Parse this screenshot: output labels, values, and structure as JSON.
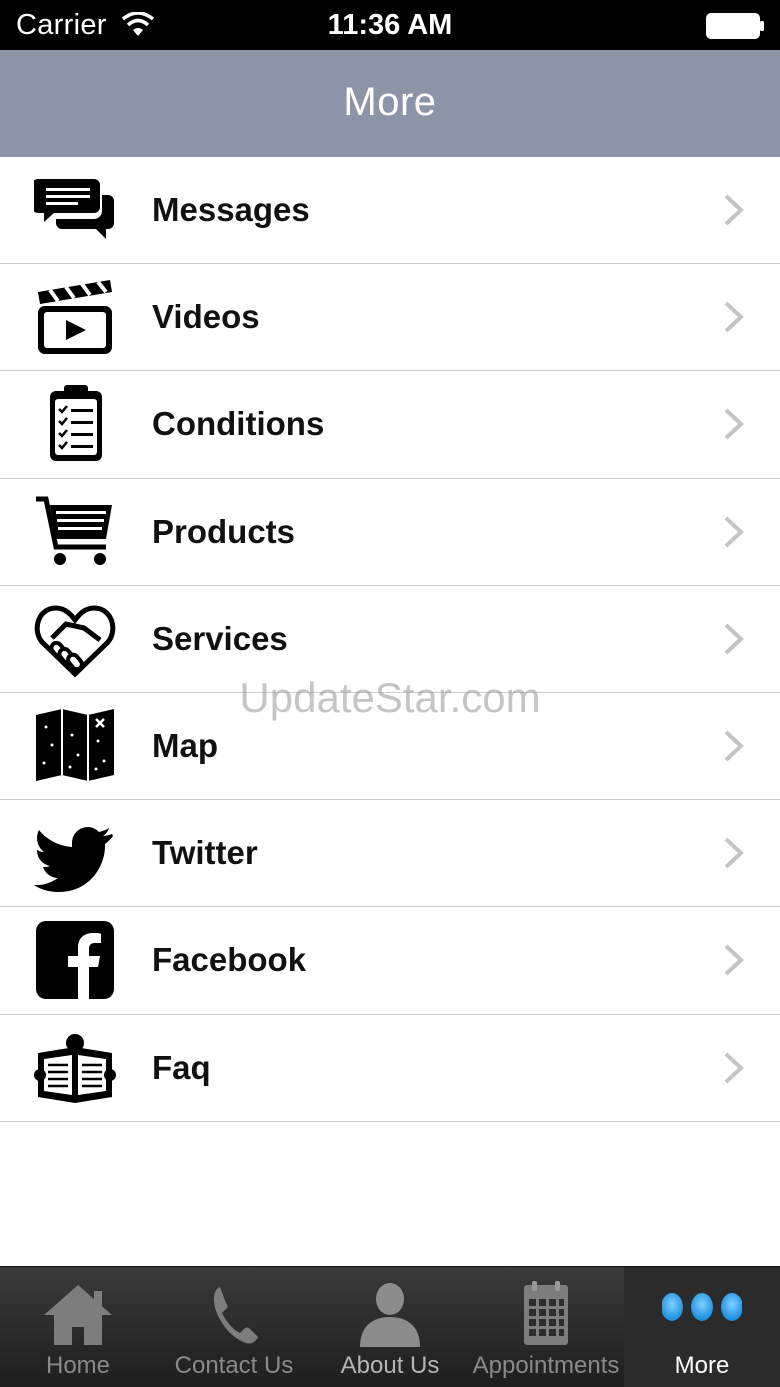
{
  "status_bar": {
    "carrier": "Carrier",
    "time": "11:36 AM"
  },
  "nav": {
    "title": "More"
  },
  "menu": [
    {
      "label": "Messages",
      "icon": "messages-icon"
    },
    {
      "label": "Videos",
      "icon": "clapperboard-icon"
    },
    {
      "label": "Conditions",
      "icon": "clipboard-icon"
    },
    {
      "label": "Products",
      "icon": "cart-icon"
    },
    {
      "label": "Services",
      "icon": "handshake-heart-icon"
    },
    {
      "label": "Map",
      "icon": "map-icon"
    },
    {
      "label": "Twitter",
      "icon": "twitter-icon"
    },
    {
      "label": "Facebook",
      "icon": "facebook-icon"
    },
    {
      "label": "Faq",
      "icon": "newspaper-icon"
    }
  ],
  "watermark": "UpdateStar.com",
  "tabs": [
    {
      "label": "Home",
      "icon": "home-icon"
    },
    {
      "label": "Contact Us",
      "icon": "phone-icon"
    },
    {
      "label": "About Us",
      "icon": "person-icon"
    },
    {
      "label": "Appointments",
      "icon": "calendar-icon"
    },
    {
      "label": "More",
      "icon": "more-dots-icon",
      "active": true
    }
  ],
  "colors": {
    "nav_background": "#8c95a8",
    "tab_active_dots": "#3fa9f5"
  }
}
